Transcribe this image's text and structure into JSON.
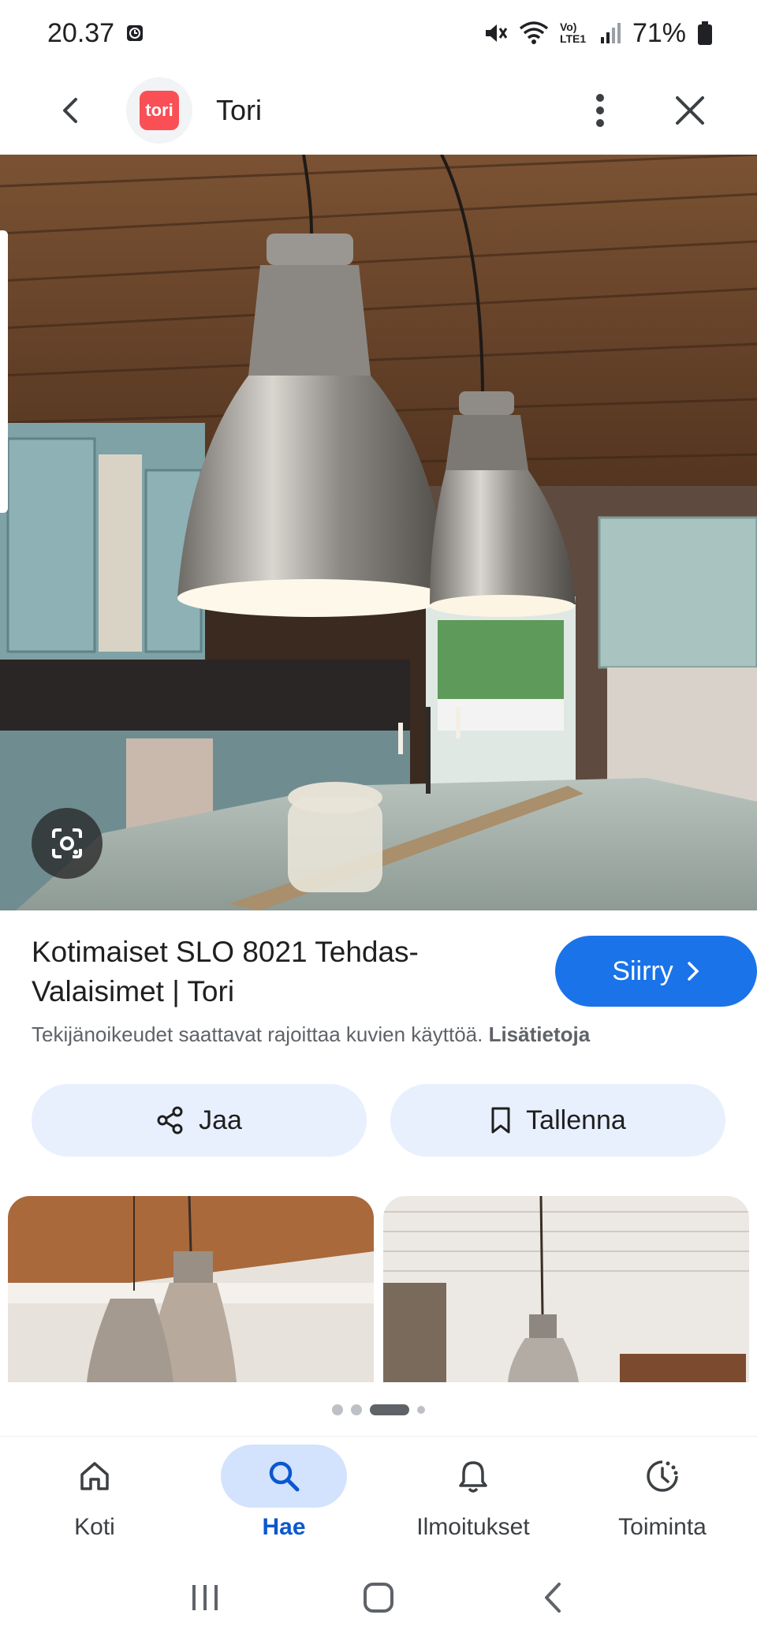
{
  "status_bar": {
    "time": "20.37",
    "battery": "71%",
    "network_label": "Vo) LTE1"
  },
  "app_bar": {
    "site_name": "Tori",
    "logo_text": "tori",
    "logo_color": "#f94f55"
  },
  "result": {
    "title": "Kotimaiset SLO 8021 Tehdas-Valaisimet | Tori",
    "visit_label": "Siirry",
    "copyright_text": "Tekijänoikeudet saattavat rajoittaa kuvien käyttöä.",
    "more_info_label": "Lisätietoja"
  },
  "actions": {
    "share_label": "Jaa",
    "save_label": "Tallenna"
  },
  "bottom_nav": {
    "items": [
      {
        "label": "Koti",
        "icon": "home-icon"
      },
      {
        "label": "Hae",
        "icon": "search-icon"
      },
      {
        "label": "Ilmoitukset",
        "icon": "bell-icon"
      },
      {
        "label": "Toiminta",
        "icon": "activity-icon"
      }
    ]
  },
  "colors": {
    "accent": "#1a73e8",
    "active_nav": "#0b57d0",
    "chip_bg": "#e8f0fe"
  }
}
